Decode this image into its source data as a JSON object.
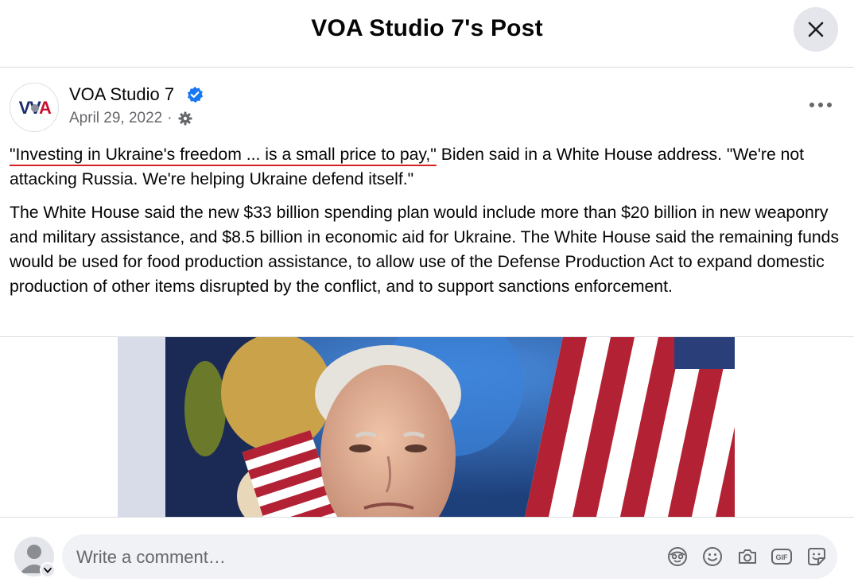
{
  "header": {
    "title": "VOA Studio 7's Post",
    "close_icon": "close-icon"
  },
  "post": {
    "author": {
      "name": "VOA Studio 7",
      "avatar_logo": "VOA",
      "verified": true
    },
    "date": "April 29, 2022",
    "separator": "·",
    "audience_icon": "gear-icon",
    "more_icon": "more-icon",
    "paragraphs": {
      "p1_quote": "\"Investing in Ukraine's freedom ... is a small price to pay,\"",
      "p1_rest": " Biden said in a White House address. \"We're not attacking Russia. We're helping Ukraine defend itself.\"",
      "p2": "The White House said the new $33 billion spending plan would include more than $20 billion in new weaponry and military assistance, and $8.5 billion in economic aid for Ukraine. The White House said the remaining funds would be used for food production assistance, to allow use of the Defense Production Act to expand domestic production of other items disrupted by the conflict, and to support sanctions enforcement."
    },
    "photo_icon": "post-photo"
  },
  "comment_box": {
    "placeholder": "Write a comment…",
    "tools": [
      "avatar-sticker-icon",
      "emoji-icon",
      "camera-icon",
      "gif-icon",
      "sticker-icon"
    ]
  },
  "colors": {
    "accent": "#1877f2",
    "secondary_text": "#65676b",
    "underline": "#d92020"
  }
}
